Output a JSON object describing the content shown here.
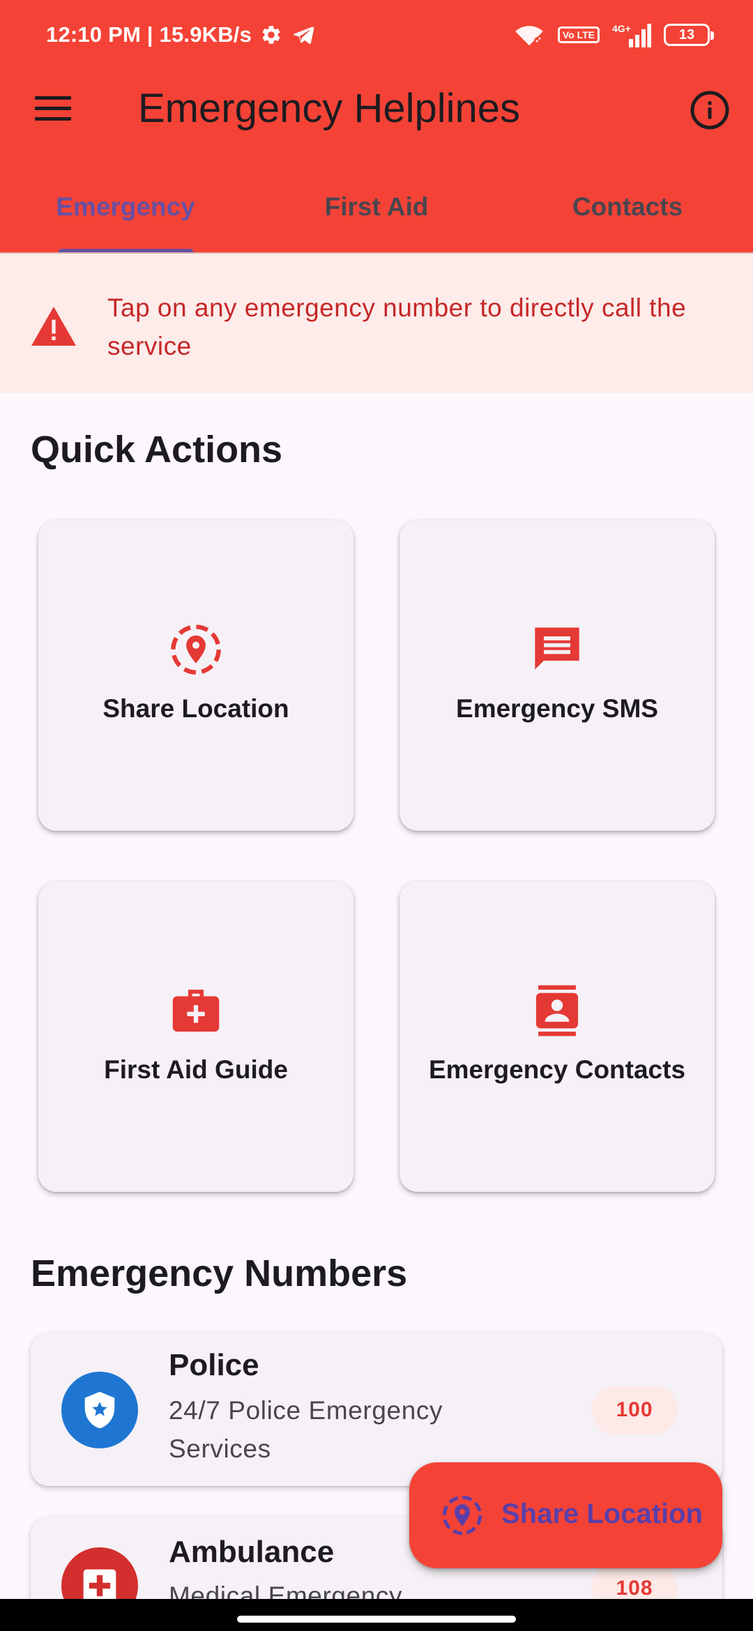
{
  "status_bar": {
    "time": "12:10 PM | 15.9KB/s",
    "volte": "Vo LTE",
    "network": "4G+",
    "battery": "13"
  },
  "app_bar": {
    "title": "Emergency Helplines"
  },
  "tabs": [
    {
      "label": "Emergency",
      "active": true
    },
    {
      "label": "First Aid",
      "active": false
    },
    {
      "label": "Contacts",
      "active": false
    }
  ],
  "notice": {
    "text": "Tap on any emergency number to directly call the service"
  },
  "quick_actions": {
    "title": "Quick Actions",
    "items": [
      {
        "label": "Share Location",
        "icon": "share-location-icon"
      },
      {
        "label": "Emergency SMS",
        "icon": "sms-icon"
      },
      {
        "label": "First Aid Guide",
        "icon": "medical-bag-icon"
      },
      {
        "label": "Emergency Contacts",
        "icon": "contacts-icon"
      }
    ]
  },
  "emergency_numbers": {
    "title": "Emergency Numbers",
    "items": [
      {
        "name": "Police",
        "description": "24/7 Police Emergency Services",
        "number": "100",
        "icon": "shield-icon",
        "color": "#1e76d2"
      },
      {
        "name": "Ambulance",
        "description": "Medical Emergency Services",
        "number": "108",
        "icon": "medical-icon",
        "color": "#d32f2f"
      }
    ]
  },
  "fab": {
    "label": "Share Location",
    "icon": "share-location-icon"
  },
  "colors": {
    "primary": "#f44336",
    "accent": "#6750a4",
    "notice_bg": "#fdecea",
    "notice_text": "#c62828"
  }
}
